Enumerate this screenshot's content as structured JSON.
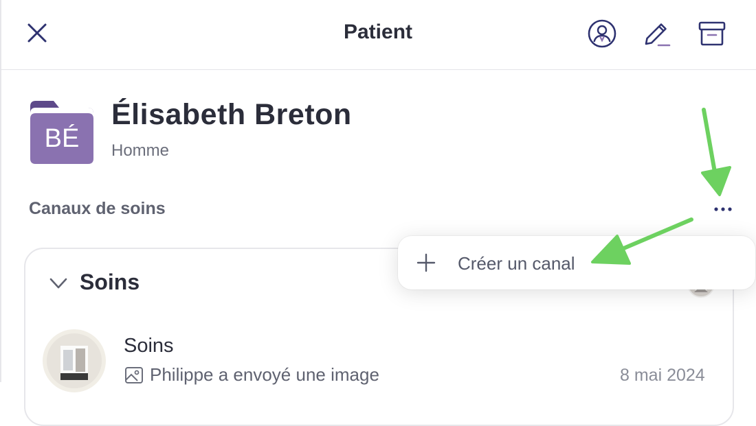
{
  "header": {
    "title": "Patient"
  },
  "patient": {
    "initials": "BÉ",
    "name": "Élisabeth Breton",
    "gender": "Homme"
  },
  "channels": {
    "section_label": "Canaux de soins",
    "groups": [
      {
        "title": "Soins",
        "items": [
          {
            "title": "Soins",
            "last_message": "Philippe a envoyé une image",
            "date": "8 mai 2024"
          }
        ]
      }
    ]
  },
  "menu": {
    "create_channel_label": "Créer un canal"
  },
  "colors": {
    "accent": "#2e3270",
    "avatar_purple": "#8a72b0",
    "annotation_arrow": "#6dd160"
  },
  "icons": {
    "close": "close-icon",
    "profile": "user-circle-icon",
    "edit": "pencil-icon",
    "archive": "archive-icon",
    "more": "more-horizontal-icon",
    "chevron": "chevron-down-icon",
    "image": "image-icon",
    "plus": "plus-icon"
  }
}
